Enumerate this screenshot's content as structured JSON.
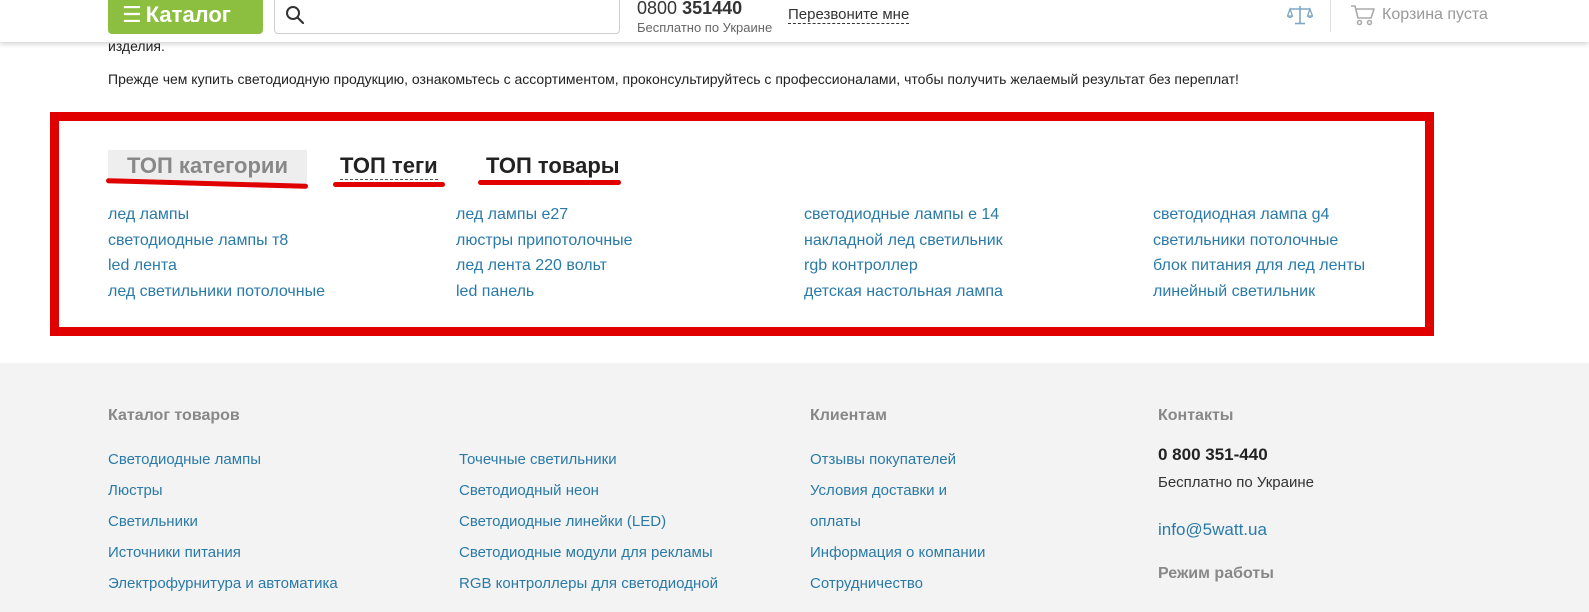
{
  "header": {
    "catalog_label": "Каталог",
    "phone_prefix": "0800",
    "phone_main": "351440",
    "phone_sub": "Бесплатно по Украине",
    "callback_label": "Перезвоните мне",
    "cart_label": "Корзина пуста"
  },
  "intro": {
    "cut_text": "изделия.",
    "text": "Прежде чем купить светодиодную продукцию, ознакомьтесь с ассортиментом, проконсультируйтесь с профессионалами, чтобы получить желаемый результат без переплат!"
  },
  "top_block": {
    "tabs": [
      "ТОП категории",
      "ТОП теги",
      "ТОП товары"
    ],
    "active_tab": "ТОП категории",
    "columns": [
      [
        "лед лампы",
        "светодиодные лампы т8",
        "led лента",
        "лед светильники потолочные"
      ],
      [
        "лед лампы е27",
        "люстры припотолочные",
        "лед лента 220 вольт",
        "led панель"
      ],
      [
        "светодиодные лампы е 14",
        "накладной лед светильник",
        "rgb контроллер",
        "детская настольная лампа"
      ],
      [
        "светодиодная лампа g4",
        "светильники потолочные",
        "блок питания для лед ленты",
        "линейный светильник"
      ]
    ],
    "highlight_color": "#e00000"
  },
  "footer": {
    "catalog_title": "Каталог товаров",
    "catalog_col1": [
      "Светодиодные лампы",
      "Люстры",
      "Светильники",
      "Источники питания",
      "Электрофурнитура и автоматика"
    ],
    "catalog_col2": [
      "Точечные светильники",
      "Светодиодный неон",
      "Светодиодные линейки (LED)",
      "Светодиодные модули для рекламы",
      "RGB контроллеры для светодиодной"
    ],
    "clients_title": "Клиентам",
    "clients_links": [
      "Отзывы покупателей",
      "Условия доставки и",
      "оплаты",
      "Информация о компании",
      "Сотрудничество"
    ],
    "contacts_title": "Контакты",
    "contacts_phone": "0 800 351-440",
    "contacts_phone_sub": "Бесплатно по Украине",
    "contacts_email": "info@5watt.ua",
    "hours_title": "Режим работы"
  },
  "colors": {
    "brand_green": "#8cbf3f",
    "link_blue": "#2a7aa8",
    "footer_bg": "#f3f3f3"
  },
  "icons": [
    "burger-icon",
    "search-icon",
    "compare-scales-icon",
    "cart-icon"
  ]
}
